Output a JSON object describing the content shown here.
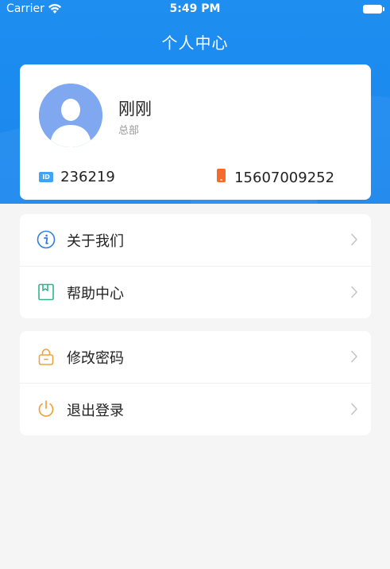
{
  "status_bar": {
    "carrier": "Carrier",
    "time": "5:49 PM"
  },
  "header": {
    "title": "个人中心"
  },
  "profile": {
    "name": "刚刚",
    "department": "总部",
    "id_badge": "ID",
    "id_number": "236219",
    "phone": "15607009252"
  },
  "menu_groups": [
    {
      "items": [
        {
          "label": "关于我们",
          "icon": "info-icon",
          "color": "#2f7ee0"
        },
        {
          "label": "帮助中心",
          "icon": "bookmark-icon",
          "color": "#34b48a"
        }
      ]
    },
    {
      "items": [
        {
          "label": "修改密码",
          "icon": "lock-icon",
          "color": "#f0a23a"
        },
        {
          "label": "退出登录",
          "icon": "power-icon",
          "color": "#f0a23a"
        }
      ]
    }
  ],
  "colors": {
    "header_blue": "#1e8ef0",
    "avatar_blue": "#7fa8f0",
    "id_icon_blue": "#3fa3f6",
    "phone_icon_orange": "#f46b2c"
  }
}
